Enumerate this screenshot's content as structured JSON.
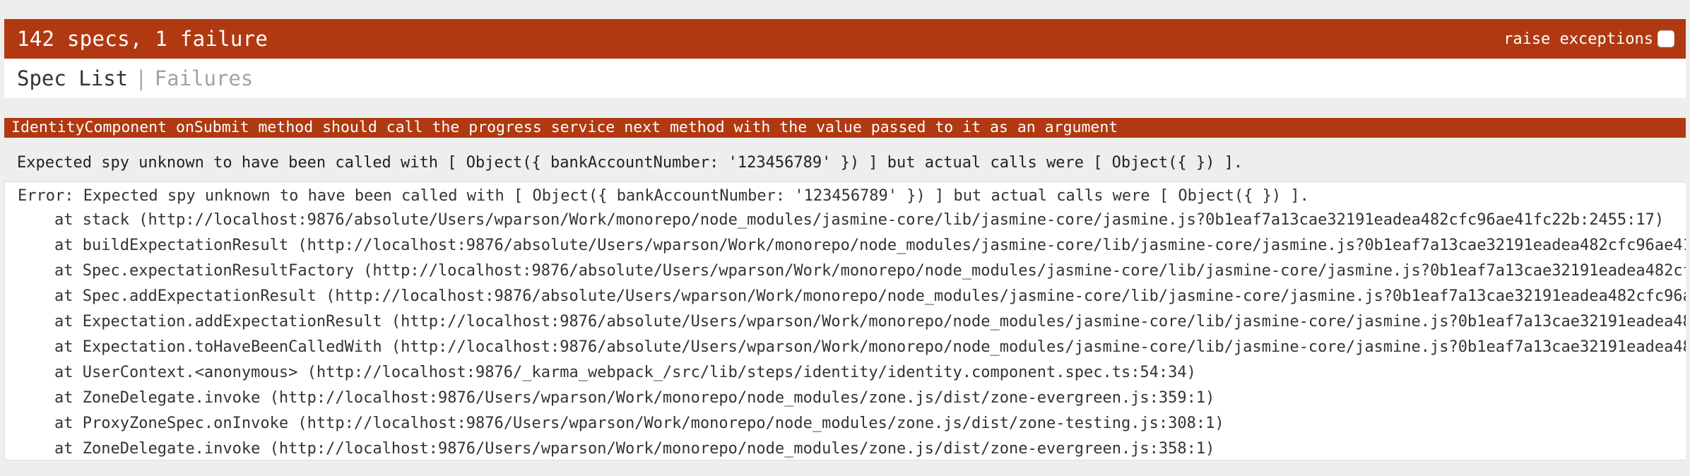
{
  "alert": {
    "title": "142 specs, 1 failure",
    "raise_exceptions_label": "raise exceptions"
  },
  "menu": {
    "spec_list_label": "Spec List",
    "separator": "|",
    "failures_label": "Failures"
  },
  "failure": {
    "description": "IdentityComponent onSubmit method should call the progress service next method with the value passed to it as an argument",
    "message": "Expected spy unknown to have been called with [ Object({ bankAccountNumber: '123456789' }) ] but actual calls were [ Object({  }) ].",
    "stack": [
      "Error: Expected spy unknown to have been called with [ Object({ bankAccountNumber: '123456789' }) ] but actual calls were [ Object({  }) ].",
      "at stack (http://localhost:9876/absolute/Users/wparson/Work/monorepo/node_modules/jasmine-core/lib/jasmine-core/jasmine.js?0b1eaf7a13cae32191eadea482cfc96ae41fc22b:2455:17)",
      "at buildExpectationResult (http://localhost:9876/absolute/Users/wparson/Work/monorepo/node_modules/jasmine-core/lib/jasmine-core/jasmine.js?0b1eaf7a13cae32191eadea482cfc96ae41",
      "at Spec.expectationResultFactory (http://localhost:9876/absolute/Users/wparson/Work/monorepo/node_modules/jasmine-core/lib/jasmine-core/jasmine.js?0b1eaf7a13cae32191eadea482cfc",
      "at Spec.addExpectationResult (http://localhost:9876/absolute/Users/wparson/Work/monorepo/node_modules/jasmine-core/lib/jasmine-core/jasmine.js?0b1eaf7a13cae32191eadea482cfc96ae",
      "at Expectation.addExpectationResult (http://localhost:9876/absolute/Users/wparson/Work/monorepo/node_modules/jasmine-core/lib/jasmine-core/jasmine.js?0b1eaf7a13cae32191eadea48",
      "at Expectation.toHaveBeenCalledWith (http://localhost:9876/absolute/Users/wparson/Work/monorepo/node_modules/jasmine-core/lib/jasmine-core/jasmine.js?0b1eaf7a13cae32191eadea48",
      "at UserContext.<anonymous> (http://localhost:9876/_karma_webpack_/src/lib/steps/identity/identity.component.spec.ts:54:34)",
      "at ZoneDelegate.invoke (http://localhost:9876/Users/wparson/Work/monorepo/node_modules/zone.js/dist/zone-evergreen.js:359:1)",
      "at ProxyZoneSpec.onInvoke (http://localhost:9876/Users/wparson/Work/monorepo/node_modules/zone.js/dist/zone-testing.js:308:1)",
      "at ZoneDelegate.invoke (http://localhost:9876/Users/wparson/Work/monorepo/node_modules/zone.js/dist/zone-evergreen.js:358:1)"
    ]
  },
  "colors": {
    "failure_red": "#b03911",
    "background": "#eeeeee"
  }
}
